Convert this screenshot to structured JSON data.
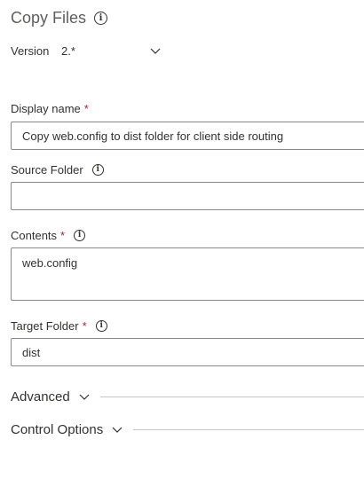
{
  "task": {
    "title": "Copy Files",
    "version_label": "Version",
    "version_value": "2.*"
  },
  "fields": {
    "display_name": {
      "label": "Display name",
      "required_mark": "*",
      "value": "Copy web.config to dist folder for client side routing"
    },
    "source_folder": {
      "label": "Source Folder",
      "value": ""
    },
    "contents": {
      "label": "Contents",
      "required_mark": "*",
      "value": "web.config"
    },
    "target_folder": {
      "label": "Target Folder",
      "required_mark": "*",
      "value": "dist"
    }
  },
  "sections": {
    "advanced": "Advanced",
    "control_options": "Control Options"
  },
  "icons": {
    "info": "info-icon",
    "chevron": "chevron-down-icon"
  },
  "colors": {
    "required": "#a4262c",
    "border": "#8a8886",
    "divider": "#c8c6c4"
  }
}
